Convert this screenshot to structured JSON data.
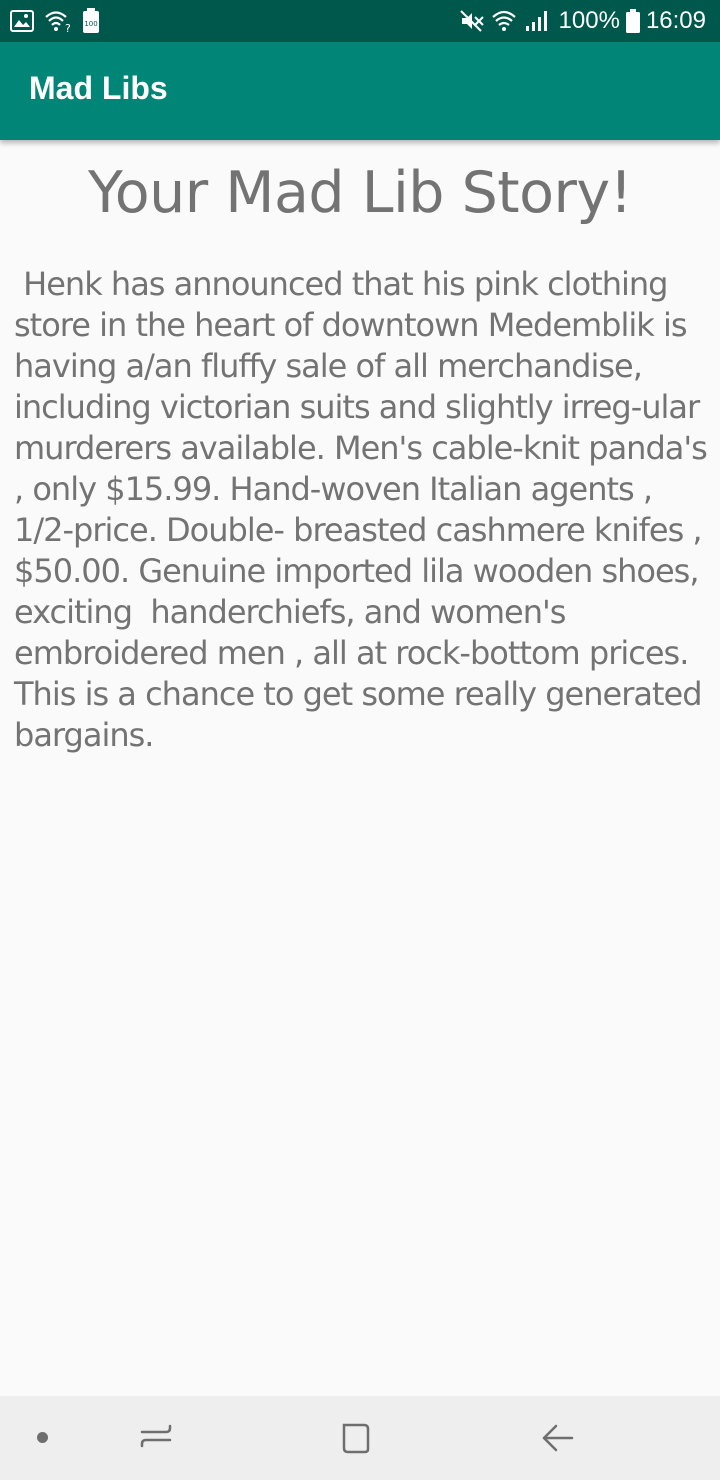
{
  "status_bar": {
    "left_icons": [
      "image-icon",
      "wifi-question-icon",
      "battery-saver-icon"
    ],
    "right_icons": [
      "mute-icon",
      "wifi-icon",
      "signal-icon",
      "battery-icon"
    ],
    "battery_percent": "100%",
    "time": "16:09",
    "battery_badge": "100"
  },
  "app_bar": {
    "title": "Mad Libs",
    "color": "#008577",
    "status_color": "#00574b"
  },
  "main": {
    "heading": "Your Mad Lib Story!",
    "story": " Henk has announced that his pink clothing store in the heart of downtown Medemblik is having a/an fluffy sale of all merchandise, including victorian suits and slightly irreg-ular murderers available. Men's cable-knit panda's , only $15.99. Hand-woven Italian agents , 1/2-price. Double- breasted cashmere knifes , $50.00. Genuine imported lila wooden shoes, exciting  handerchiefs, and women's embroidered men , all at rock-bottom prices. This is a chance to get some really generated bargains."
  },
  "nav_bar": {
    "buttons": [
      "dot-icon",
      "recents-icon",
      "home-icon",
      "back-icon"
    ]
  }
}
